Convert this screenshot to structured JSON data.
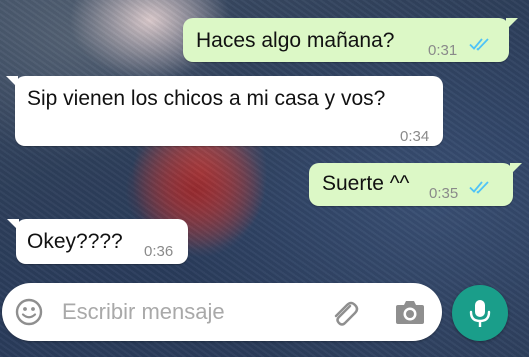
{
  "messages": [
    {
      "direction": "outgoing",
      "text": "Haces algo mañana?",
      "time": "0:31",
      "status": "read"
    },
    {
      "direction": "incoming",
      "text": "Sip vienen los chicos a mi casa y vos?",
      "time": "0:34"
    },
    {
      "direction": "outgoing",
      "text": "Suerte ^^",
      "time": "0:35",
      "status": "read"
    },
    {
      "direction": "incoming",
      "text": "Okey????",
      "time": "0:36"
    }
  ],
  "composer": {
    "placeholder": "Escribir mensaje"
  },
  "colors": {
    "outgoing_bubble": "#dcf8c6",
    "incoming_bubble": "#ffffff",
    "read_ticks": "#4fc3f7",
    "mic_button": "#1a9e8a"
  },
  "icons": [
    "emoji-icon",
    "attach-icon",
    "camera-icon",
    "mic-icon",
    "double-check-icon"
  ]
}
